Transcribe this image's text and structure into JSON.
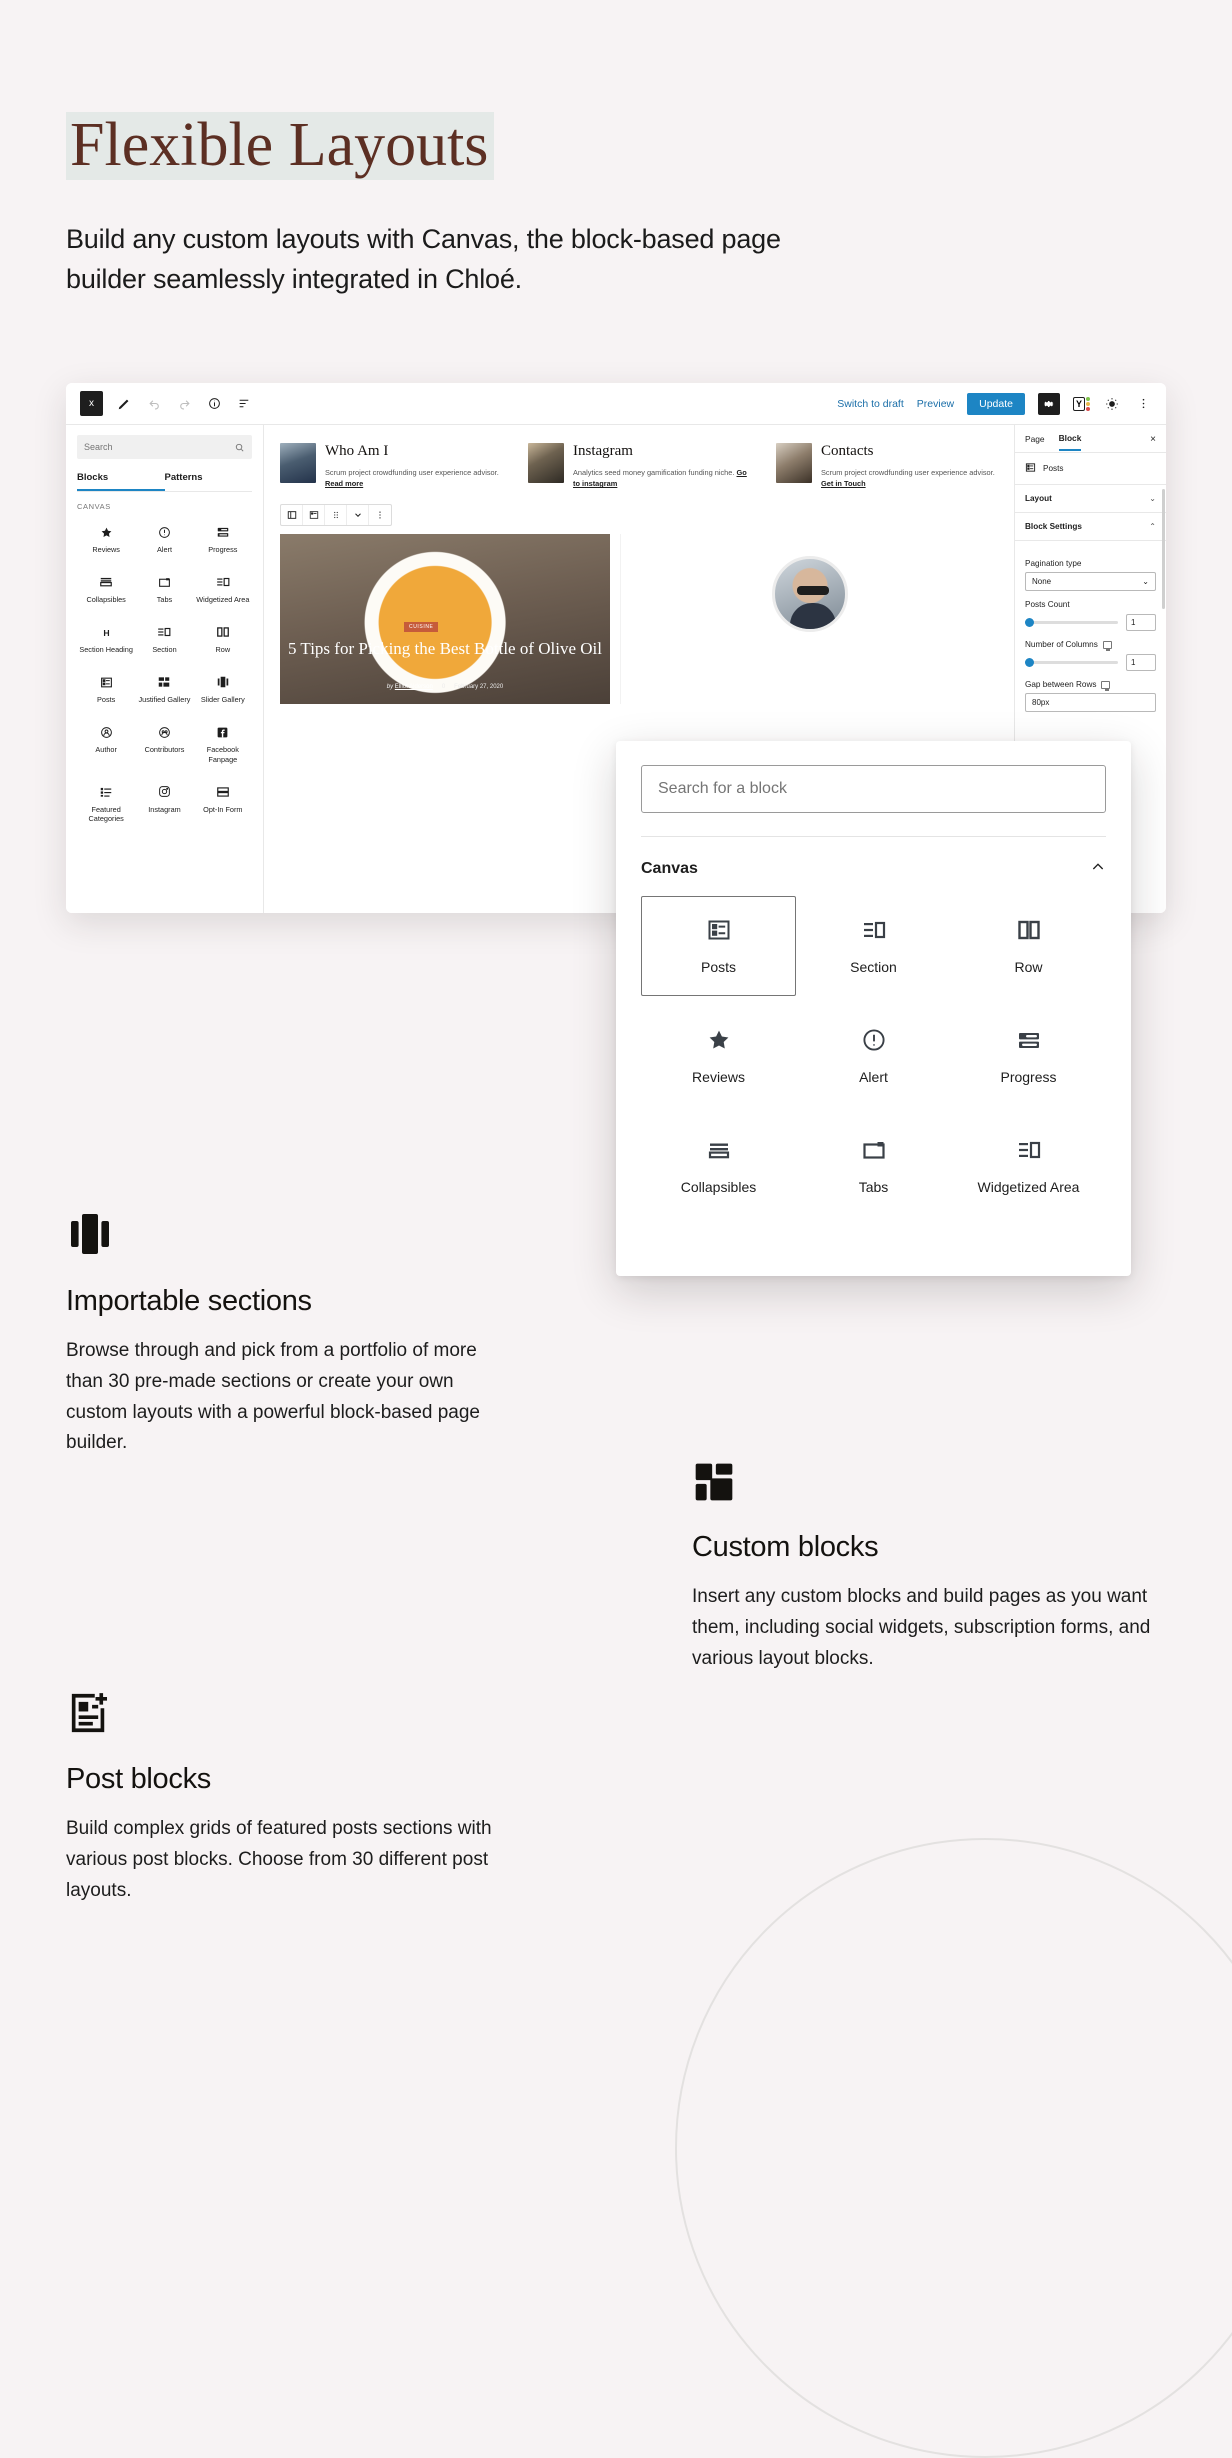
{
  "hero": {
    "title": "Flexible Layouts",
    "subtitle": "Build any custom layouts with Canvas, the block-based page builder seamlessly integrated in Chloé.",
    "highlight_color": "#e4e9e7",
    "title_color": "#5c2f23"
  },
  "editor": {
    "toolbar": {
      "logo_label": "x",
      "icons": [
        "wordpress-logo",
        "edit-pencil-icon",
        "undo-icon",
        "redo-icon",
        "info-icon",
        "list-view-icon"
      ],
      "switch_to_draft": "Switch to draft",
      "preview": "Preview",
      "update": "Update",
      "update_color": "#1d85c4",
      "right_icons": [
        "settings-gear-icon",
        "yoast-seo-icon",
        "brightness-icon",
        "more-options-icon"
      ]
    },
    "inserter_sidebar": {
      "search_placeholder": "Search",
      "tabs": [
        {
          "label": "Blocks",
          "active": true
        },
        {
          "label": "Patterns",
          "active": false
        }
      ],
      "category": "CANVAS",
      "blocks": [
        {
          "label": "Reviews",
          "icon": "star-icon"
        },
        {
          "label": "Alert",
          "icon": "alert-circle-icon"
        },
        {
          "label": "Progress",
          "icon": "progress-bars-icon"
        },
        {
          "label": "Collapsibles",
          "icon": "collapsibles-icon"
        },
        {
          "label": "Tabs",
          "icon": "tabs-icon"
        },
        {
          "label": "Widgetized Area",
          "icon": "widgetized-area-icon"
        },
        {
          "label": "Section Heading",
          "icon": "heading-h-icon"
        },
        {
          "label": "Section",
          "icon": "section-icon"
        },
        {
          "label": "Row",
          "icon": "row-columns-icon"
        },
        {
          "label": "Posts",
          "icon": "posts-list-icon"
        },
        {
          "label": "Justified Gallery",
          "icon": "justified-gallery-icon"
        },
        {
          "label": "Slider Gallery",
          "icon": "slider-gallery-icon"
        },
        {
          "label": "Author",
          "icon": "author-avatar-icon"
        },
        {
          "label": "Contributors",
          "icon": "contributors-icon"
        },
        {
          "label": "Facebook Fanpage",
          "icon": "facebook-icon"
        },
        {
          "label": "Featured Categories",
          "icon": "featured-categories-icon"
        },
        {
          "label": "Instagram",
          "icon": "instagram-icon"
        },
        {
          "label": "Opt-In Form",
          "icon": "opt-in-form-icon"
        }
      ]
    },
    "canvas": {
      "columns": [
        {
          "title": "Who Am I",
          "text": "Scrum project crowdfunding user experience advisor.",
          "link": "Read more"
        },
        {
          "title": "Instagram",
          "text": "Analytics seed money gamification funding niche.",
          "link": "Go to instagram"
        },
        {
          "title": "Contacts",
          "text": "Scrum project crowdfunding user experience advisor.",
          "link": "Get in Touch"
        }
      ],
      "featured_post": {
        "badge": "CUISINE",
        "title": "5 Tips for Picking the Best Bottle of Olive Oil",
        "author_prefix": "by",
        "author": "Elliot Alderson",
        "comments": "0",
        "date": "February 27, 2020"
      }
    },
    "settings_panel": {
      "tabs": [
        {
          "label": "Page",
          "active": false
        },
        {
          "label": "Block",
          "active": true
        }
      ],
      "close_label": "×",
      "block_name": "Posts",
      "sections": [
        {
          "label": "Layout",
          "expanded": false
        },
        {
          "label": "Block Settings",
          "expanded": true
        }
      ],
      "fields": {
        "pagination_type_label": "Pagination type",
        "pagination_type_value": "None",
        "posts_count_label": "Posts Count",
        "posts_count_value": "1",
        "number_of_columns_label": "Number of Columns",
        "number_of_columns_value": "1",
        "gap_between_rows_label": "Gap between Rows",
        "gap_between_rows_value": "80px"
      }
    }
  },
  "block_inserter": {
    "search_placeholder": "Search for a block",
    "category": "Canvas",
    "collapse_icon": "chevron-up-icon",
    "blocks": [
      {
        "label": "Posts",
        "icon": "posts-list-icon",
        "selected": true
      },
      {
        "label": "Section",
        "icon": "section-icon",
        "selected": false
      },
      {
        "label": "Row",
        "icon": "row-columns-icon",
        "selected": false
      },
      {
        "label": "Reviews",
        "icon": "star-icon",
        "selected": false
      },
      {
        "label": "Alert",
        "icon": "alert-circle-icon",
        "selected": false
      },
      {
        "label": "Progress",
        "icon": "progress-bars-icon",
        "selected": false
      },
      {
        "label": "Collapsibles",
        "icon": "collapsibles-icon",
        "selected": false
      },
      {
        "label": "Tabs",
        "icon": "tabs-icon",
        "selected": false
      },
      {
        "label": "Widgetized Area",
        "icon": "widgetized-area-icon",
        "selected": false
      }
    ]
  },
  "features": [
    {
      "icon": "slider-gallery-icon",
      "title": "Importable sections",
      "text": "Browse through and pick from a portfolio of more than 30 pre-made sections or create your own custom layouts with a powerful block-based page builder."
    },
    {
      "icon": "grid-blocks-icon",
      "title": "Custom blocks",
      "text": "Insert any custom blocks and build pages as you want them, including social widgets, subscription forms, and various layout blocks."
    },
    {
      "icon": "post-add-icon",
      "title": "Post blocks",
      "text": "Build complex grids of featured posts sections with various post blocks. Choose from 30 different post layouts."
    }
  ]
}
